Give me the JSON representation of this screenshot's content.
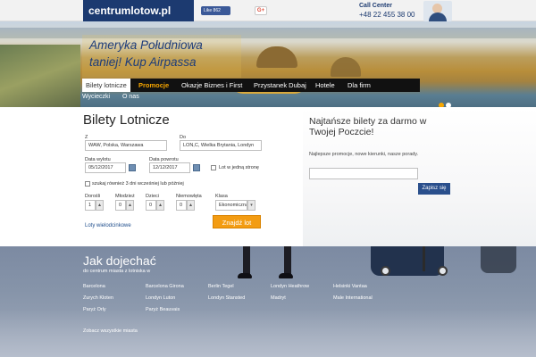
{
  "header": {
    "logo": "centrumlotow.pl",
    "fb_label": "Like 862",
    "gplus_label": "G+",
    "call_center_title": "Call Center",
    "call_center_phone": "+48 22 455 38 00"
  },
  "hero": {
    "headline_line1": "Ameryka Południowa",
    "headline_line2": "taniej! Kup Airpassa"
  },
  "nav": {
    "items": [
      "Bilety lotnicze",
      "Promocje",
      "Okazje Biznes i First",
      "Przystanek Dubaj",
      "Hotele",
      "Dla firm"
    ],
    "subnav": [
      "Wycieczki",
      "O nas"
    ]
  },
  "search": {
    "title": "Bilety Lotnicze",
    "from_label": "Z",
    "from_value": "WAW, Polska, Warszawa",
    "to_label": "Do",
    "to_value": "LON,C, Wielka Brytania, Londyn",
    "depart_label": "Data wylotu",
    "depart_value": "05/12/2017",
    "return_label": "Data powrotu",
    "return_value": "12/12/2017",
    "one_way_label": "Lot w jedną stronę",
    "flex_label": "szukaj również 3 dni wcześniej lub później",
    "adults_label": "Dorośli",
    "adults_value": "1",
    "youth_label": "Młodzież",
    "youth_value": "0",
    "children_label": "Dzieci",
    "children_value": "0",
    "infants_label": "Niemowlęta",
    "infants_value": "0",
    "class_label": "Klasa",
    "class_value": "Ekonomiczna",
    "multi_link": "Loty wielodcinkowe",
    "submit_label": "Znajdź lot"
  },
  "newsletter": {
    "title": "Najtańsze bilety za darmo w Twojej Poczcie!",
    "description": "Najlepsze promocje, nowe kierunki, nasze porady.",
    "button_label": "Zapisz się",
    "email_value": ""
  },
  "directions": {
    "title": "Jak dojechać",
    "subtitle": "do centrum miasta z lotniska w",
    "cities": [
      "Barcelona",
      "Barcelona Girona",
      "Berlin Tegel",
      "Londyn Heathrow",
      "Helsinki Vantaa",
      "Zurych Kloten",
      "Londyn Luton",
      "Londyn Stansted",
      "Madryt",
      "Male International",
      "Paryż Orly",
      "Paryż Beauvais"
    ],
    "see_all": "Zobacz wszystkie miasta"
  },
  "colors": {
    "brand_blue": "#1c3a70",
    "accent_orange": "#f39c12",
    "nav_bg": "#111111",
    "newsletter_button": "#2a4f8c"
  },
  "hero_slider": {
    "total": 2,
    "active_index": 0
  }
}
